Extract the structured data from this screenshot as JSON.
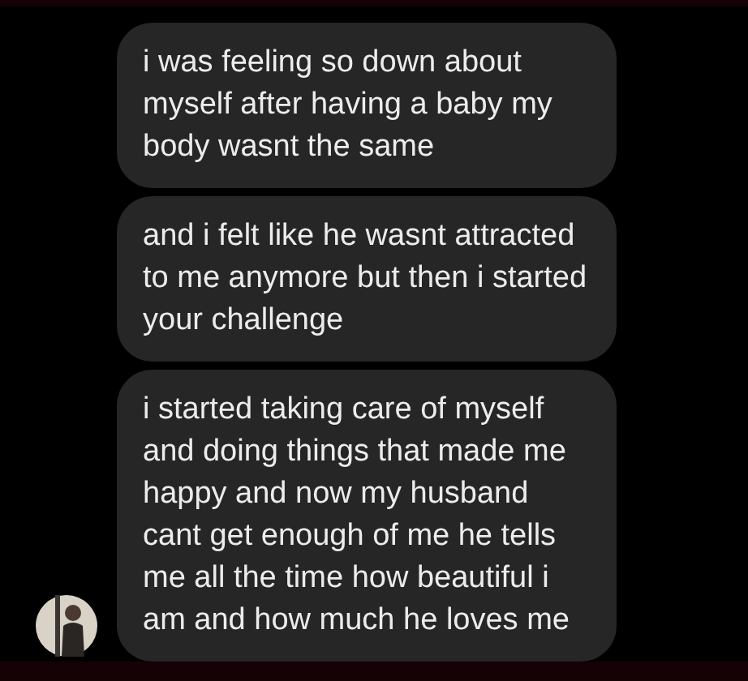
{
  "messages": [
    {
      "text": "i was feeling so down about myself after having a baby my body wasnt the same",
      "avatar": false
    },
    {
      "text": "and i felt like he wasnt attracted to me anymore but then i started your challenge",
      "avatar": false
    },
    {
      "text": "i started taking care of myself and doing things that made me happy and now my husband cant get enough of me he tells me all the time how beautiful i am and how much he loves me",
      "avatar": true
    }
  ]
}
